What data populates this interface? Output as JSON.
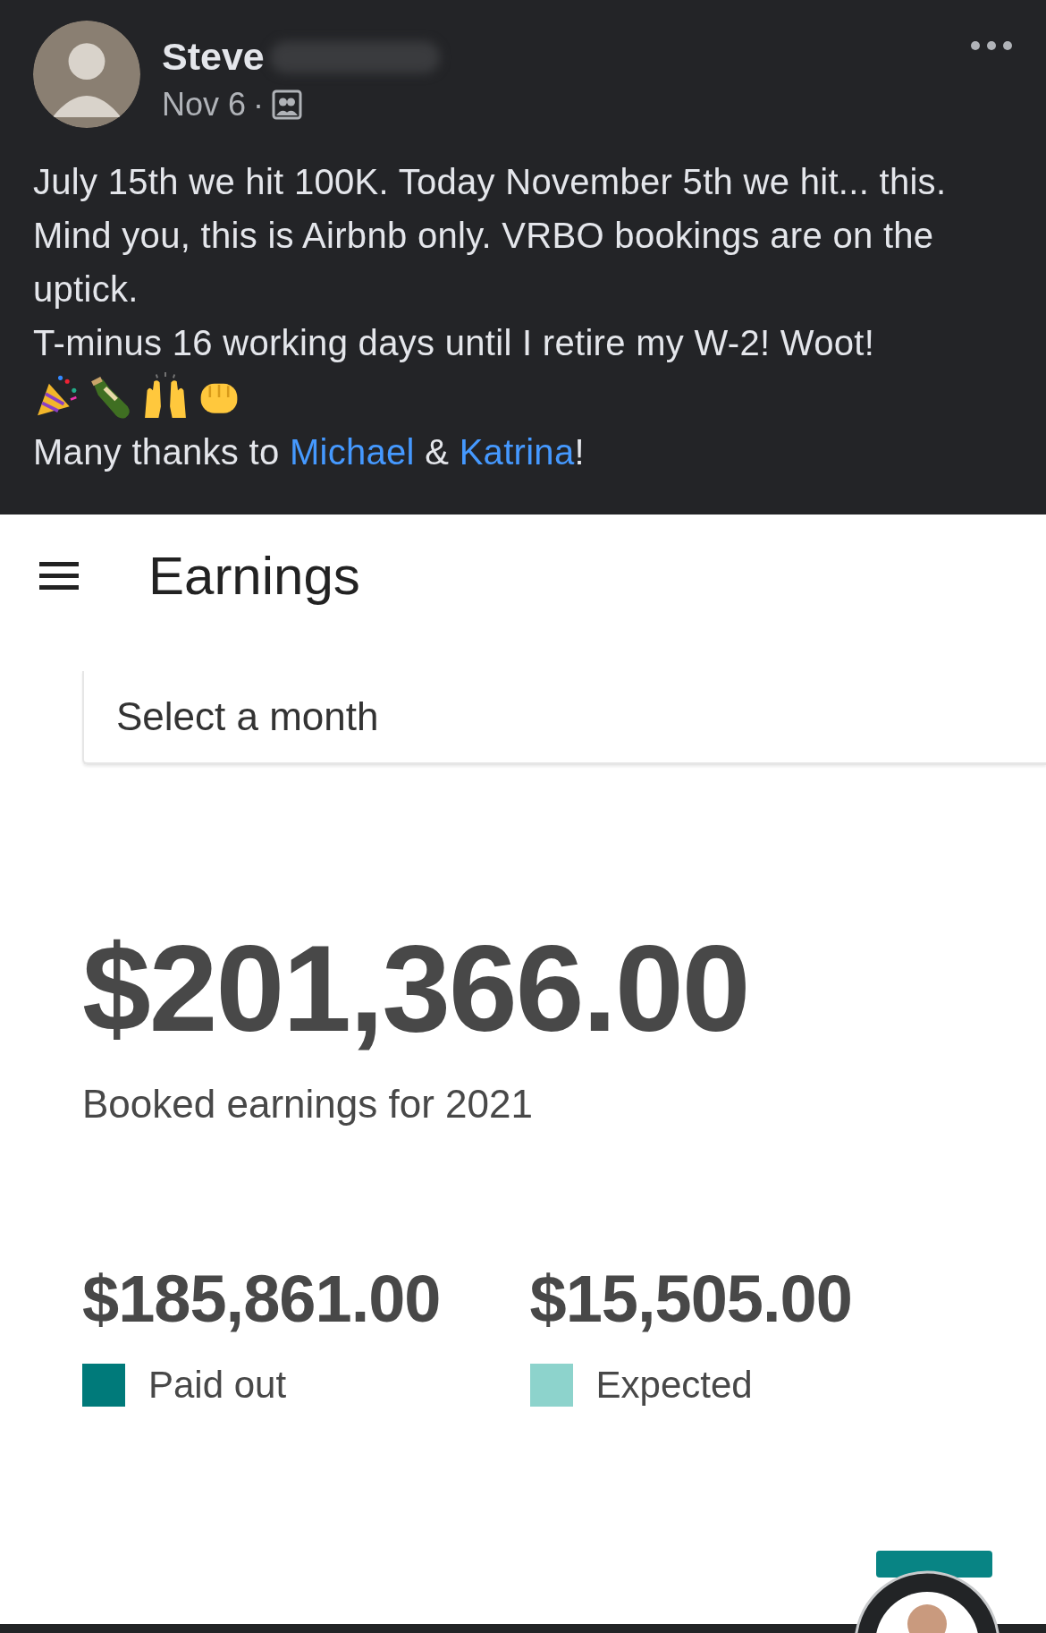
{
  "post": {
    "author": "Steve",
    "date": "Nov 6",
    "separator": "·",
    "paragraphs": [
      "July 15th we hit 100K. Today November 5th we hit... this. Mind you, this is Airbnb only. VRBO bookings are on the uptick.",
      "T-minus 16 working days until I retire my W-2! Woot!"
    ],
    "emojis": [
      {
        "kind": "party"
      },
      {
        "kind": "bottle"
      },
      {
        "kind": "hands"
      },
      {
        "kind": "fist"
      }
    ],
    "thanks": [
      {
        "kind": "text",
        "text": "Many thanks to "
      },
      {
        "kind": "link",
        "text": "Michael"
      },
      {
        "kind": "text",
        "text": " & "
      },
      {
        "kind": "link",
        "text": "Katrina"
      },
      {
        "kind": "text",
        "text": "!"
      }
    ]
  },
  "earnings": {
    "title": "Earnings",
    "select": {
      "placeholder": "Select a month"
    },
    "total": "$201,366.00",
    "caption": "Booked earnings for 2021",
    "breakdown": [
      {
        "amount": "$185,861.00",
        "label": "Paid out",
        "color": "#007a7a"
      },
      {
        "amount": "$15,505.00",
        "label": "Expected",
        "color": "#8dd3cc"
      }
    ]
  }
}
